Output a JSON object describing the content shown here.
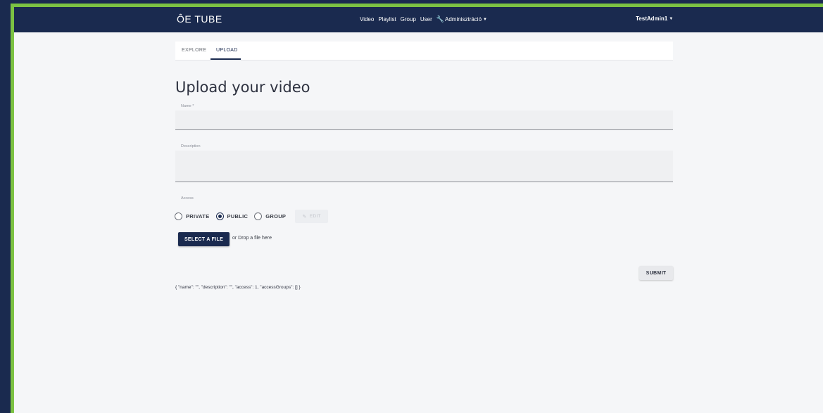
{
  "navbar": {
    "brand": "ÔE TUBE",
    "links": [
      "Video",
      "Playlist",
      "Group",
      "User"
    ],
    "admin_label": "Adminisztráció",
    "user_label": "TestAdmin1"
  },
  "tabs": {
    "explore": "EXPLORE",
    "upload": "UPLOAD"
  },
  "form": {
    "title": "Upload your video",
    "name_label": "Name *",
    "name_value": "",
    "description_label": "Description",
    "description_value": "",
    "access_label": "Access",
    "access_options": [
      "PRIVATE",
      "PUBLIC",
      "GROUP"
    ],
    "access_selected": "PUBLIC",
    "edit_label": "EDIT",
    "select_file_label": "SELECT A FILE",
    "drop_text": "or Drop a file here",
    "submit_label": "SUBMIT",
    "debug_json": "{ \"name\": \"\", \"description\": \"\", \"access\": 1, \"accessGroups\": [] }"
  },
  "colors": {
    "primary": "#1a2a4f",
    "frame_accent": "#7cc243",
    "background": "#f5f6f8"
  }
}
